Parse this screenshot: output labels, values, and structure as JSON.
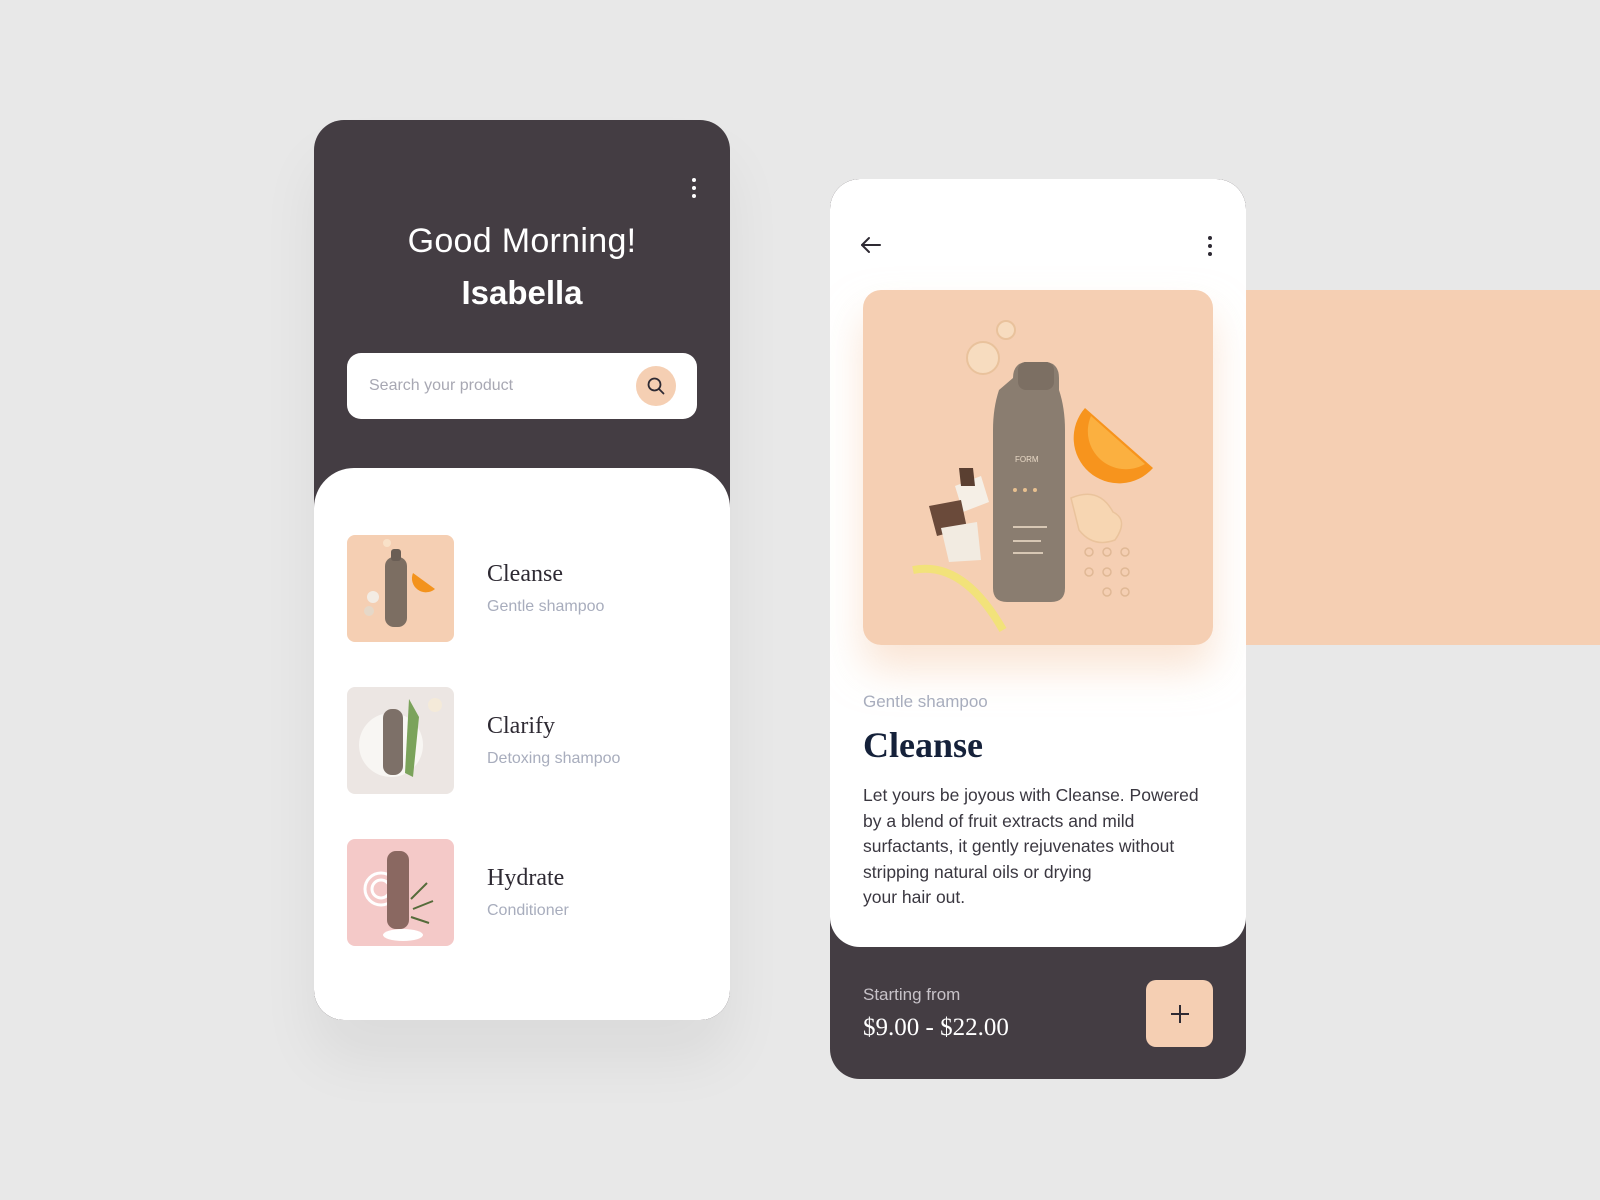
{
  "colors": {
    "background": "#e8e8e8",
    "dark": "#443d43",
    "peach": "#f5cfb3",
    "card": "#ffffff",
    "muted_text": "#a8adbd",
    "title_navy": "#15213a"
  },
  "home": {
    "greeting": "Good Morning!",
    "user_name": "Isabella",
    "menu_icon": "more-vertical-icon",
    "search": {
      "placeholder": "Search your product",
      "icon": "search-icon"
    },
    "products": [
      {
        "title": "Cleanse",
        "subtitle": "Gentle shampoo"
      },
      {
        "title": "Clarify",
        "subtitle": "Detoxing shampoo"
      },
      {
        "title": "Hydrate",
        "subtitle": "Conditioner"
      }
    ]
  },
  "detail": {
    "back_icon": "arrow-left-icon",
    "menu_icon": "more-vertical-icon",
    "subtitle": "Gentle shampoo",
    "title": "Cleanse",
    "description": "Let yours be joyous with Cleanse. Powered\nby a blend of fruit extracts and mild\nsurfactants, it gently rejuvenates without\nstripping natural oils or drying\nyour hair out.",
    "price_label": "Starting from",
    "price_range": "$9.00 - $22.00",
    "add_icon": "plus-icon"
  }
}
